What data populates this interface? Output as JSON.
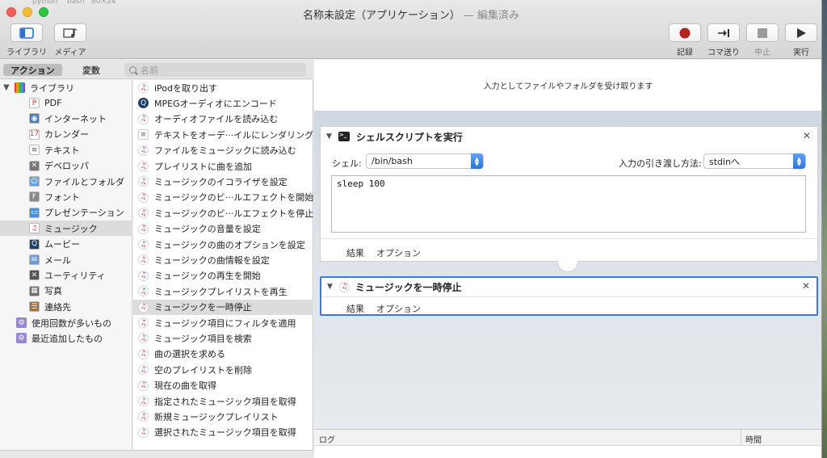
{
  "window": {
    "background_tab": "python    bash   80×24",
    "title": "名称未設定（アプリケーション）",
    "edited": " — 編集済み"
  },
  "toolbar": {
    "library_label": "ライブラリ",
    "media_label": "メディア",
    "record_label": "記録",
    "step_label": "コマ送り",
    "stop_label": "中止",
    "run_label": "実行"
  },
  "left_header": {
    "actions_tab": "アクション",
    "variables_tab": "変数",
    "search_placeholder": "名前"
  },
  "library": {
    "root": "ライブラリ",
    "items": [
      "PDF",
      "インターネット",
      "カレンダー",
      "テキスト",
      "デベロッパ",
      "ファイルとフォルダ",
      "フォント",
      "プレゼンテーション",
      "ミュージック",
      "ムービー",
      "メール",
      "ユーティリティ",
      "写真",
      "連絡先"
    ],
    "smart": [
      "使用回数が多いもの",
      "最近追加したもの"
    ],
    "selected": "ミュージック"
  },
  "actions": {
    "items": [
      "iPodを取り出す",
      "MPEGオーディオにエンコード",
      "オーディオファイルを読み込む",
      "テキストをオーデ···イルにレンダリング",
      "ファイルをミュージックに読み込む",
      "プレイリストに曲を追加",
      "ミュージックのイコライザを設定",
      "ミュージックのビ···ルエフェクトを開始",
      "ミュージックのビ···ルエフェクトを停止",
      "ミュージックの音量を設定",
      "ミュージックの曲のオプションを設定",
      "ミュージックの曲情報を設定",
      "ミュージックの再生を開始",
      "ミュージックプレイリストを再生",
      "ミュージックを一時停止",
      "ミュージック項目にフィルタを適用",
      "ミュージック項目を検索",
      "曲の選択を求める",
      "空のプレイリストを削除",
      "現在の曲を取得",
      "指定されたミュージック項目を取得",
      "新規ミュージックプレイリスト",
      "選択されたミュージック項目を取得"
    ],
    "selected": "ミュージックを一時停止"
  },
  "workflow": {
    "input_text": "入力としてファイルやフォルダを受け取ります",
    "shell_card": {
      "title": "シェルスクリプトを実行",
      "shell_label": "シェル:",
      "shell_value": "/bin/bash",
      "pass_label": "入力の引き渡し方法:",
      "pass_value": "stdinへ",
      "script": "sleep 100",
      "tab_results": "結果",
      "tab_options": "オプション"
    },
    "pause_card": {
      "title": "ミュージックを一時停止",
      "tab_results": "結果",
      "tab_options": "オプション"
    }
  },
  "log": {
    "col_log": "ログ",
    "col_time": "時間"
  }
}
